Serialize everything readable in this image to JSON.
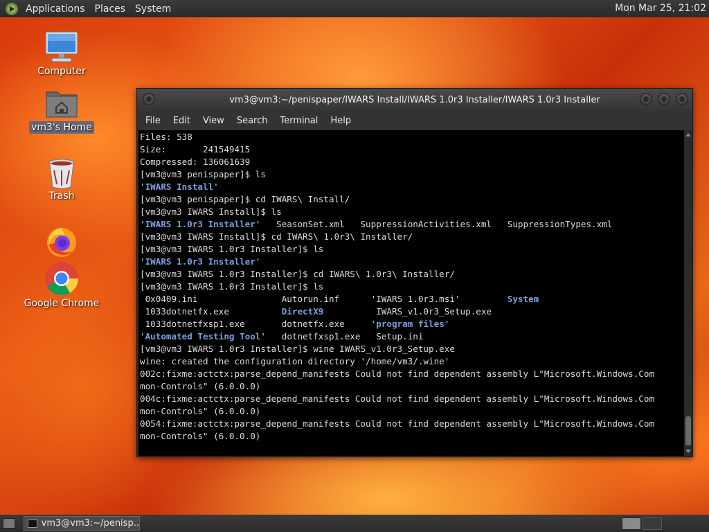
{
  "top_panel": {
    "menus": [
      "Applications",
      "Places",
      "System"
    ],
    "clock": "Mon Mar 25, 21:02"
  },
  "desktop_icons": {
    "computer": "Computer",
    "home": "vm3's Home",
    "trash": "Trash",
    "chrome": "Google Chrome"
  },
  "terminal": {
    "title": "vm3@vm3:~/penispaper/IWARS Install/IWARS 1.0r3 Installer/IWARS 1.0r3 Installer",
    "menu": [
      "File",
      "Edit",
      "View",
      "Search",
      "Terminal",
      "Help"
    ],
    "lines": [
      "Files: 538",
      "Size:       241549415",
      "Compressed: 136061639",
      "[vm3@vm3 penispaper]$ ls",
      "'IWARS Install'",
      "[vm3@vm3 penispaper]$ cd IWARS\\ Install/",
      "[vm3@vm3 IWARS Install]$ ls",
      "'IWARS 1.0r3 Installer'   SeasonSet.xml   SuppressionActivities.xml   SuppressionTypes.xml",
      "[vm3@vm3 IWARS Install]$ cd IWARS\\ 1.0r3\\ Installer/",
      "[vm3@vm3 IWARS 1.0r3 Installer]$ ls",
      "'IWARS 1.0r3 Installer'",
      "[vm3@vm3 IWARS 1.0r3 Installer]$ cd IWARS\\ 1.0r3\\ Installer/",
      "[vm3@vm3 IWARS 1.0r3 Installer]$ ls",
      " 0x0409.ini                Autorun.inf      'IWARS 1.0r3.msi'         System",
      " 1033dotnetfx.exe          DirectX9          IWARS_v1.0r3_Setup.exe",
      " 1033dotnetfxsp1.exe       dotnetfx.exe     'program files'",
      "'Automated Testing Tool'   dotnetfxsp1.exe   Setup.ini",
      "[vm3@vm3 IWARS 1.0r3 Installer]$ wine IWARS_v1.0r3_Setup.exe",
      "wine: created the configuration directory '/home/vm3/.wine'",
      "002c:fixme:actctx:parse_depend_manifests Could not find dependent assembly L\"Microsoft.Windows.Com",
      "mon-Controls\" (6.0.0.0)",
      "004c:fixme:actctx:parse_depend_manifests Could not find dependent assembly L\"Microsoft.Windows.Com",
      "mon-Controls\" (6.0.0.0)",
      "0054:fixme:actctx:parse_depend_manifests Could not find dependent assembly L\"Microsoft.Windows.Com",
      "mon-Controls\" (6.0.0.0)"
    ],
    "dir_color": "#7aa0d8"
  },
  "bottom_panel": {
    "task_label": "vm3@vm3:~/penisp..."
  }
}
